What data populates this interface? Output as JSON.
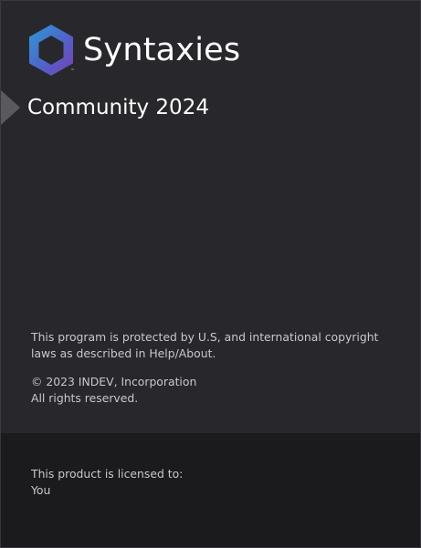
{
  "window": {
    "product_name": "Syntaxies",
    "trademark": "™",
    "edition": "Community 2024"
  },
  "icons": {
    "logo": "hexagon-logo-icon",
    "edition_marker": "triangle-marker-icon"
  },
  "colors": {
    "background": "#28282c",
    "footer_background": "#1b1b1d",
    "logo_gradient_start": "#2a9bd8",
    "logo_gradient_end": "#7a3db5"
  },
  "legal": {
    "protection_notice": "This program is protected by U.S, and international copyright laws as described in Help/About.",
    "copyright_line": "© 2023 INDEV, Incorporation",
    "rights_line": "All rights reserved."
  },
  "license": {
    "label": "This product is licensed to:",
    "licensee": "You"
  }
}
